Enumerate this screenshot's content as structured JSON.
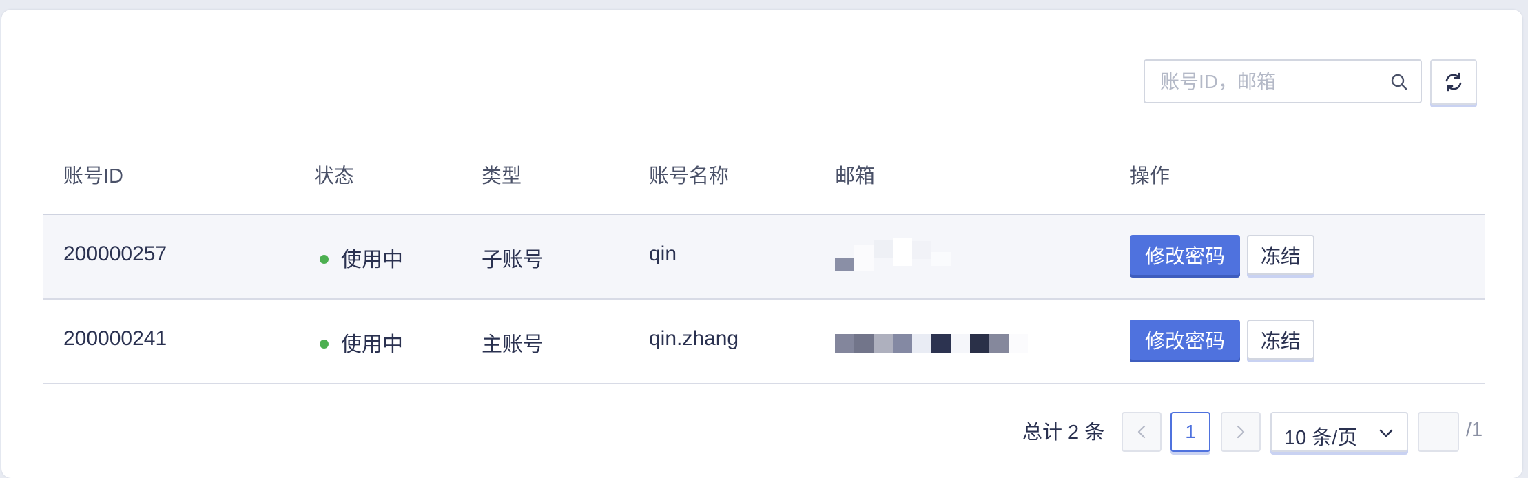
{
  "toolbar": {
    "search_placeholder": "账号ID，邮箱",
    "search_icon": "search-icon",
    "refresh_icon": "refresh-icon"
  },
  "table": {
    "headers": [
      "账号ID",
      "状态",
      "类型",
      "账号名称",
      "邮箱",
      "操作"
    ],
    "rows": [
      {
        "id": "200000257",
        "status": "使用中",
        "type": "子账号",
        "name": "qin",
        "email": "",
        "action_primary": "修改密码",
        "action_secondary": "冻结"
      },
      {
        "id": "200000241",
        "status": "使用中",
        "type": "主账号",
        "name": "qin.zhang",
        "email": "",
        "action_primary": "修改密码",
        "action_secondary": "冻结"
      }
    ]
  },
  "pagination": {
    "total_text": "总计 2 条",
    "current_page": "1",
    "page_size": "10 条/页",
    "page_total": "/1",
    "prev_icon": "chevron-left-icon",
    "next_icon": "chevron-right-icon",
    "dropdown_icon": "chevron-down-icon"
  },
  "colors": {
    "accent": "#4f72de",
    "status_active": "#4caf50",
    "text": "#2a3150",
    "border": "#d2d6e0",
    "row_highlight": "#f5f6fa"
  }
}
